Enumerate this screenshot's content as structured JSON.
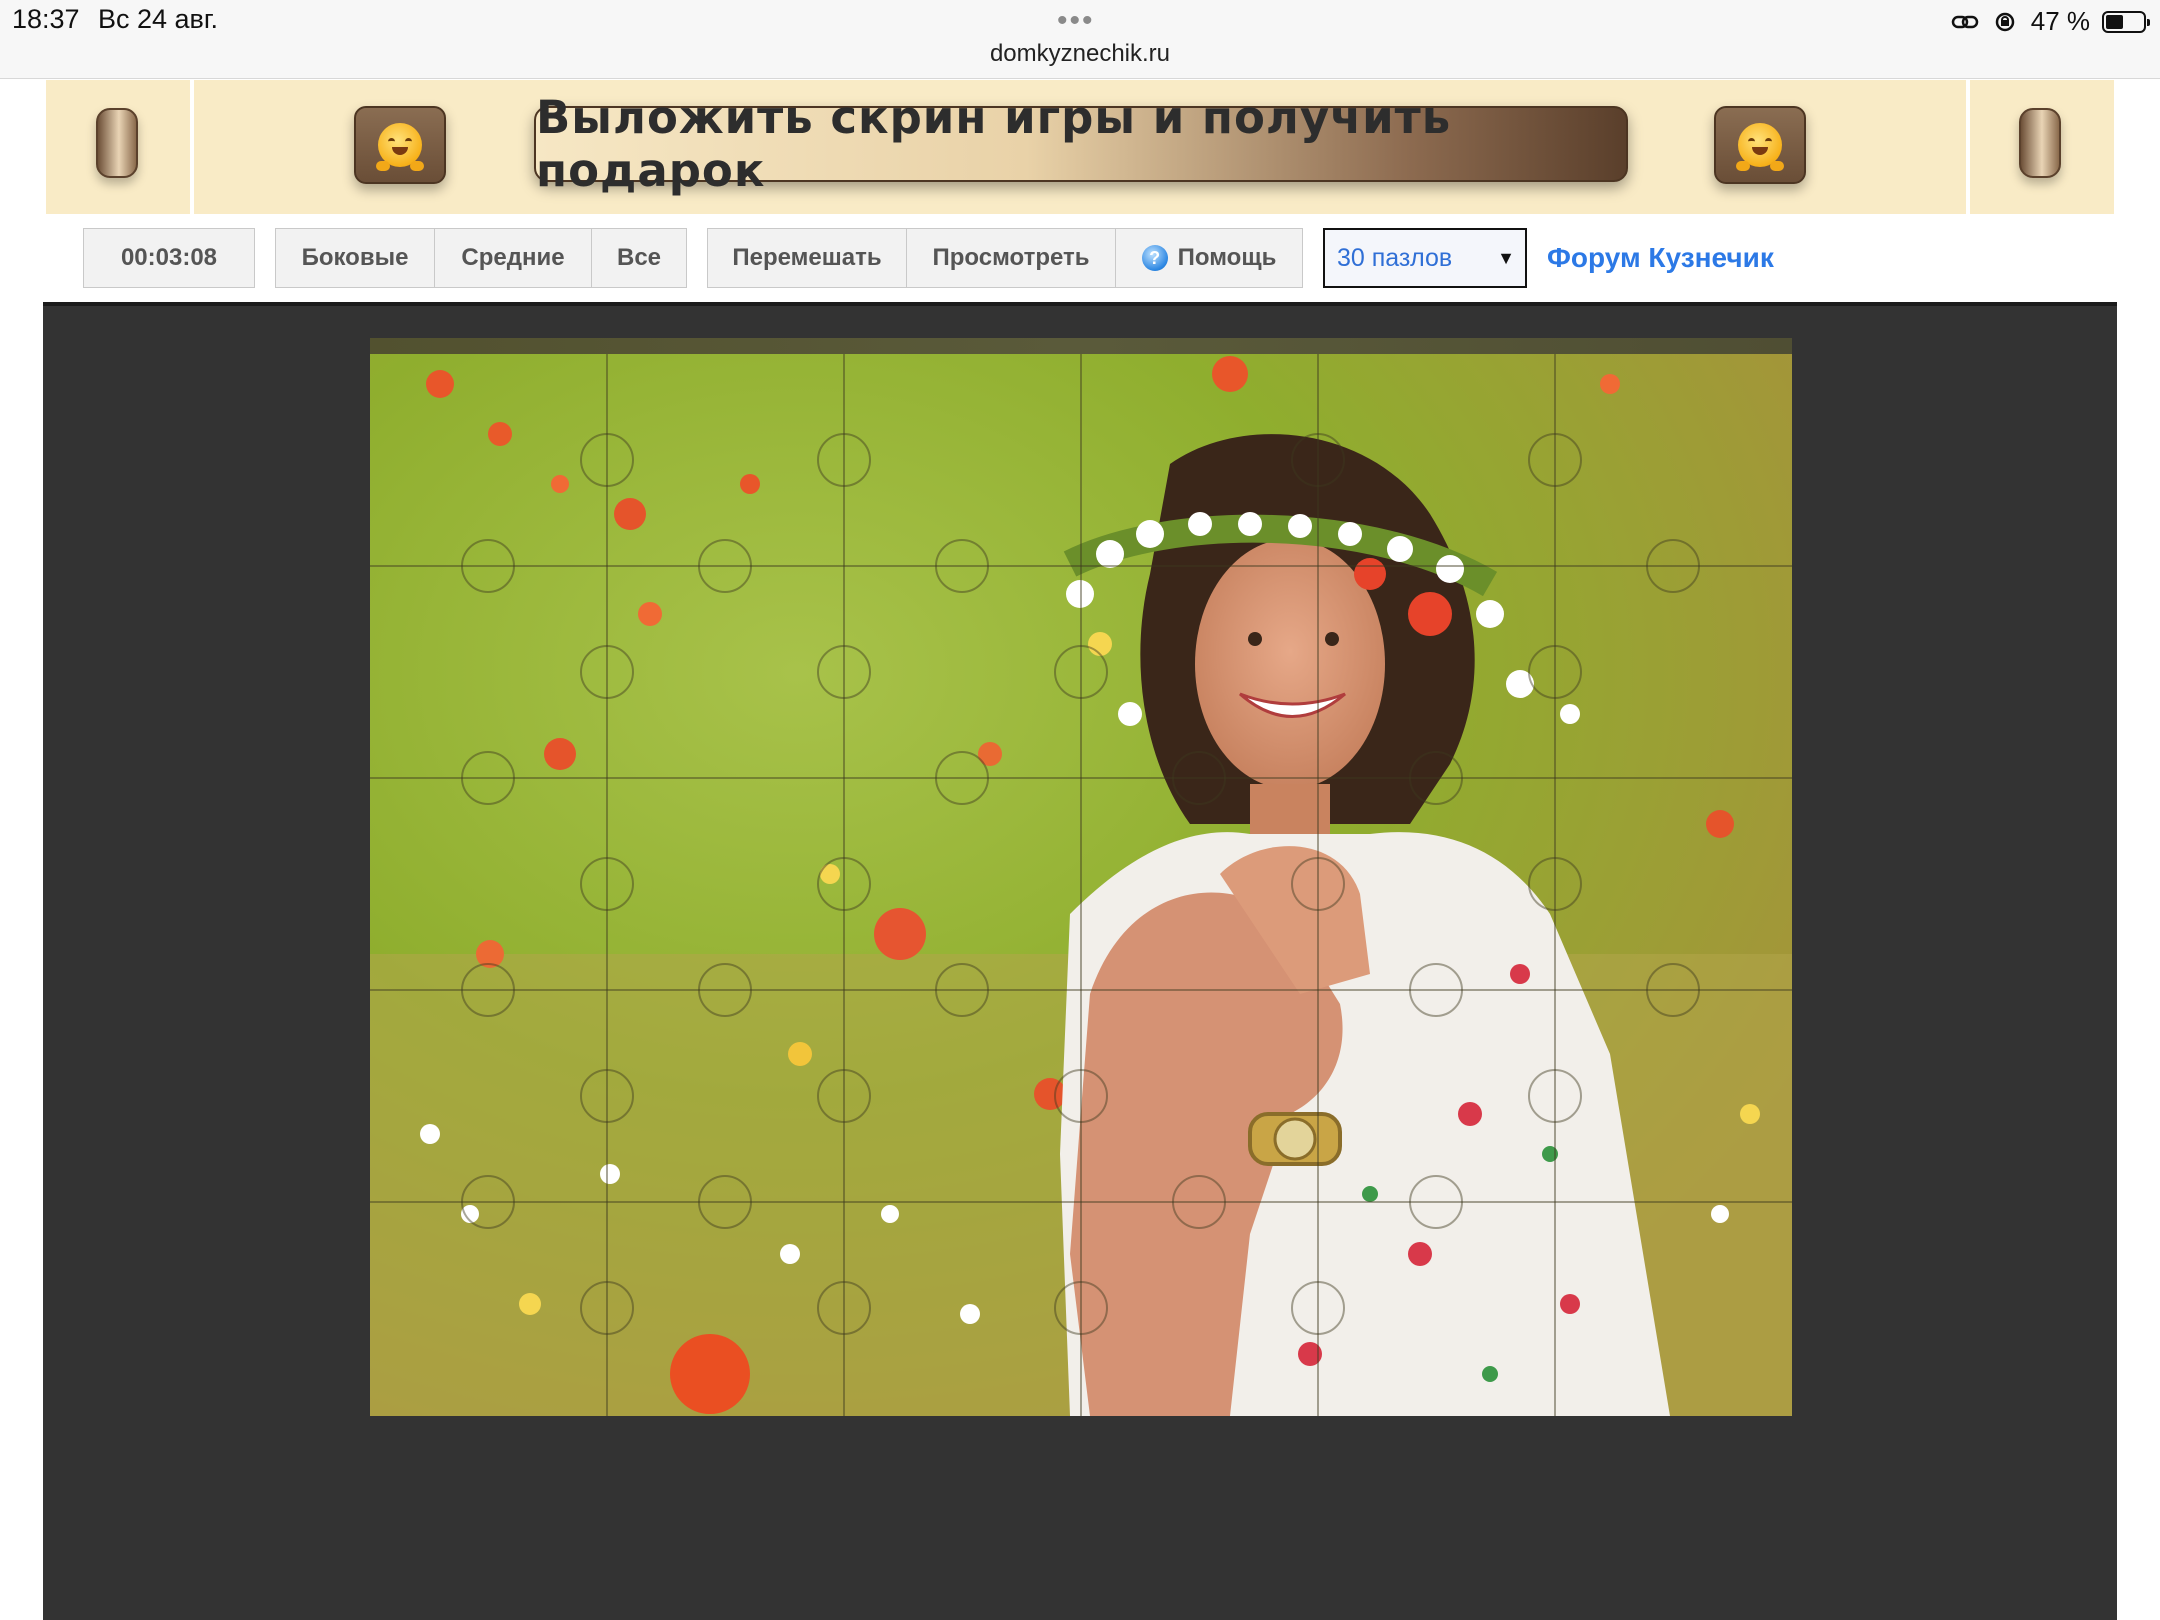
{
  "status_bar": {
    "time": "18:37",
    "date": "Вс 24 авг.",
    "dots": "•••",
    "url": "domkyznechik.ru",
    "battery_text": "47 %",
    "battery_level": 0.47
  },
  "banner": {
    "text": "Выложить скрин игры и получить подарок",
    "left_emoji": "hugging-face-icon",
    "right_emoji": "hugging-face-icon"
  },
  "toolbar": {
    "timer": "00:03:08",
    "filter_edges": "Боковые",
    "filter_middle": "Средние",
    "filter_all": "Все",
    "shuffle": "Перемешать",
    "preview": "Просмотреть",
    "help": "Помощь",
    "help_icon": "question-icon",
    "piece_count_selected": "30 пазлов",
    "forum_link": "Форум Кузнечик"
  },
  "puzzle": {
    "columns": 6,
    "rows": 5,
    "image_description": "woman-in-flower-field"
  },
  "colors": {
    "banner_bg": "#f9ebc6",
    "board_bg": "#333333",
    "link_blue": "#2c79e6"
  }
}
